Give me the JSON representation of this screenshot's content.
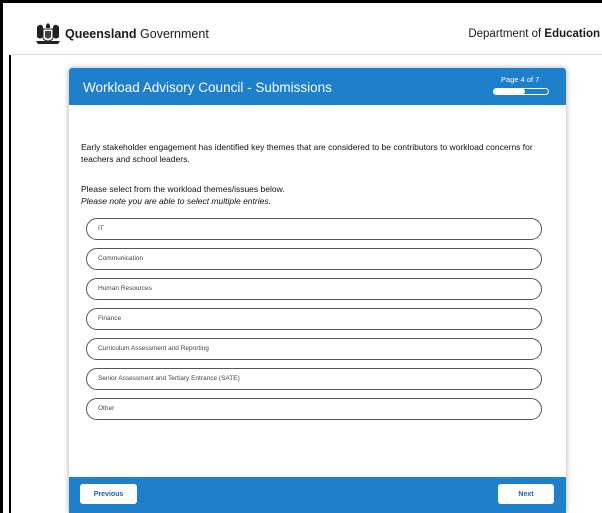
{
  "header": {
    "brand_bold": "Queensland",
    "brand_regular": " Government",
    "department_prefix": "Department of ",
    "department_bold": "Education"
  },
  "form": {
    "title": "Workload Advisory Council - Submissions",
    "page_indicator": "Page 4 of 7",
    "progress_fraction": 0.57,
    "intro": "Early stakeholder engagement has identified key themes that are considered to be contributors to workload concerns for teachers and school leaders.",
    "instruction": "Please select from the workload themes/issues below.",
    "note": "Please note you are able to select multiple entries.",
    "options": [
      "IT",
      "Communication",
      "Human Resources",
      "Finance",
      "Curriculum Assessment and Reporting",
      "Senior Assessment and Tertiary Entrance (SATE)",
      "Other"
    ]
  },
  "footer": {
    "previous_label": "Previous",
    "next_label": "Next"
  },
  "colors": {
    "accent": "#1e7fcb"
  },
  "icons": {
    "crest": "queensland-crest-icon"
  }
}
